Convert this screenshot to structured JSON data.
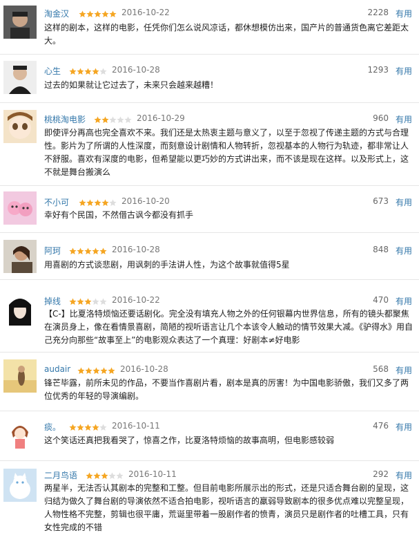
{
  "useful_label": "有用",
  "colors": {
    "link": "#3377aa",
    "star_on": "#f5a623",
    "star_off": "#dddddd"
  },
  "reviews": [
    {
      "user": "淘金汉",
      "rating": 5,
      "date": "2016-10-22",
      "votes": "2228",
      "text": "这样的剧本，这样的电影，任凭你们怎么说风凉话，都休想模仿出来，国产片的普通货色离它差距太大。"
    },
    {
      "user": "心生",
      "rating": 4,
      "date": "2016-10-28",
      "votes": "1293",
      "text": "过去的如果就让它过去了，未来只会越来越糟！"
    },
    {
      "user": "桃桃淘电影",
      "rating": 2,
      "date": "2016-10-29",
      "votes": "960",
      "text": "即使评分再高也完全喜欢不来。我们还是太热衷主题与意义了，以至于忽视了传递主题的方式与合理性。影片为了所谓的人性深度，而刻意设计剧情和人物转折，忽视基本的人物行为轨迹，都非常让人不舒服。喜欢有深度的电影，但希望能以更巧妙的方式讲出来，而不该是现在这样。以及形式上，这不就是舞台搬演么"
    },
    {
      "user": "不小可",
      "rating": 4,
      "date": "2016-10-20",
      "votes": "673",
      "text": "幸好有个民国，不然借古讽今都没有抓手"
    },
    {
      "user": "阿珂",
      "rating": 5,
      "date": "2016-10-28",
      "votes": "848",
      "text": "用喜剧的方式谈悲剧，用讽刺的手法讲人性，为这个故事就值得5星"
    },
    {
      "user": "掉线",
      "rating": 3,
      "date": "2016-10-22",
      "votes": "470",
      "text": "【C-】比夏洛特烦恼还要话剧化。完全没有填充人物之外的任何银幕内世界信息，所有的镜头都聚焦在演员身上，像在看情景喜剧，简陋的视听语言让几个本该令人触动的情节效果大减。《驴得水》用自己充分向那些“故事至上”的电影观众表达了一个真理：好剧本≠好电影"
    },
    {
      "user": "audair",
      "rating": 5,
      "date": "2016-10-28",
      "votes": "568",
      "text": "锋芒毕露，前所未见的作品，不要当作喜剧片看，剧本是真的厉害！为中国电影骄傲，我们又多了两位优秀的年轻的导演编剧。"
    },
    {
      "user": "痰。",
      "rating": 4,
      "date": "2016-10-11",
      "votes": "476",
      "text": "这个笑话还真把我看哭了，惊喜之作，比夏洛特烦恼的故事高明，但电影感较弱"
    },
    {
      "user": "二月鸟语",
      "rating": 3,
      "date": "2016-10-11",
      "votes": "292",
      "text": "两星半，无法否认其剧本的完整和工整。但目前电影所展示出的形式，还是只适合舞台剧的呈现，这归结为做久了舞台剧的导演依然不适合拍电影，视听语言的羸弱导致剧本的很多优点难以完整呈现，人物性格不完整，剪辑也很平庸，荒诞里带着一股剧作者的愤青，演员只是剧作者的吐槽工具，只有女性完成的不错"
    }
  ]
}
